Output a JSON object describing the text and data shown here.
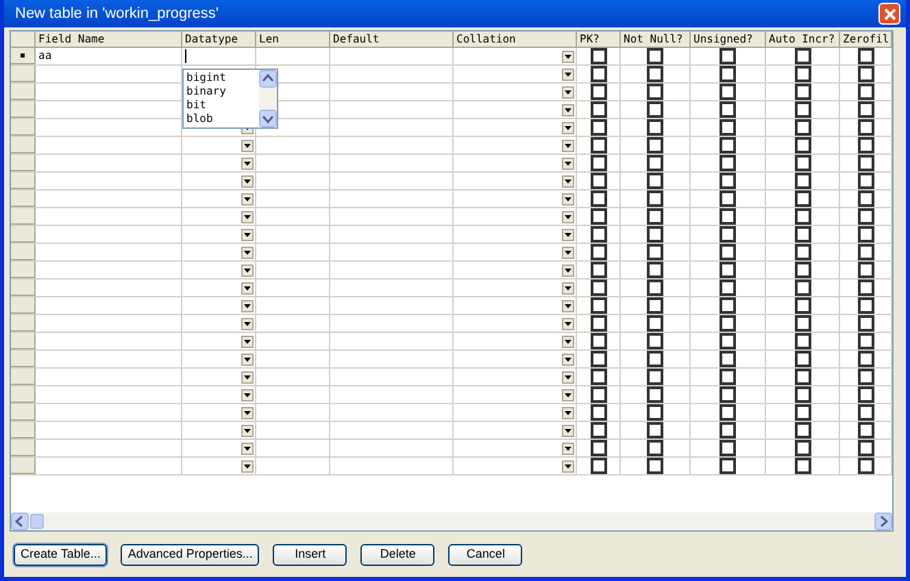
{
  "window": {
    "title": "New table in 'workin_progress'"
  },
  "columns": [
    "Field Name",
    "Datatype",
    "Len",
    "Default",
    "Collation",
    "PK?",
    "Not Null?",
    "Unsigned?",
    "Auto Incr?",
    "Zerofil"
  ],
  "rows": [
    {
      "field_name": "aa",
      "current": true,
      "checks": [
        false,
        false,
        false,
        false,
        false
      ]
    },
    {
      "field_name": "",
      "current": false,
      "checks": [
        false,
        false,
        false,
        false,
        false
      ]
    },
    {
      "field_name": "",
      "current": false,
      "checks": [
        false,
        false,
        false,
        false,
        false
      ]
    },
    {
      "field_name": "",
      "current": false,
      "checks": [
        false,
        false,
        false,
        false,
        false
      ]
    },
    {
      "field_name": "",
      "current": false,
      "checks": [
        false,
        false,
        false,
        false,
        false
      ]
    },
    {
      "field_name": "",
      "current": false,
      "checks": [
        false,
        false,
        false,
        false,
        false
      ]
    },
    {
      "field_name": "",
      "current": false,
      "checks": [
        false,
        false,
        false,
        false,
        false
      ]
    },
    {
      "field_name": "",
      "current": false,
      "checks": [
        false,
        false,
        false,
        false,
        false
      ]
    },
    {
      "field_name": "",
      "current": false,
      "checks": [
        false,
        false,
        false,
        false,
        false
      ]
    },
    {
      "field_name": "",
      "current": false,
      "checks": [
        false,
        false,
        false,
        false,
        false
      ]
    },
    {
      "field_name": "",
      "current": false,
      "checks": [
        false,
        false,
        false,
        false,
        false
      ]
    },
    {
      "field_name": "",
      "current": false,
      "checks": [
        false,
        false,
        false,
        false,
        false
      ]
    },
    {
      "field_name": "",
      "current": false,
      "checks": [
        false,
        false,
        false,
        false,
        false
      ]
    },
    {
      "field_name": "",
      "current": false,
      "checks": [
        false,
        false,
        false,
        false,
        false
      ]
    },
    {
      "field_name": "",
      "current": false,
      "checks": [
        false,
        false,
        false,
        false,
        false
      ]
    },
    {
      "field_name": "",
      "current": false,
      "checks": [
        false,
        false,
        false,
        false,
        false
      ]
    },
    {
      "field_name": "",
      "current": false,
      "checks": [
        false,
        false,
        false,
        false,
        false
      ]
    },
    {
      "field_name": "",
      "current": false,
      "checks": [
        false,
        false,
        false,
        false,
        false
      ]
    },
    {
      "field_name": "",
      "current": false,
      "checks": [
        false,
        false,
        false,
        false,
        false
      ]
    },
    {
      "field_name": "",
      "current": false,
      "checks": [
        false,
        false,
        false,
        false,
        false
      ]
    },
    {
      "field_name": "",
      "current": false,
      "checks": [
        false,
        false,
        false,
        false,
        false
      ]
    },
    {
      "field_name": "",
      "current": false,
      "checks": [
        false,
        false,
        false,
        false,
        false
      ]
    },
    {
      "field_name": "",
      "current": false,
      "checks": [
        false,
        false,
        false,
        false,
        false
      ]
    },
    {
      "field_name": "",
      "current": false,
      "checks": [
        false,
        false,
        false,
        false,
        false
      ]
    }
  ],
  "datatype_dropdown": {
    "items": [
      "bigint",
      "binary",
      "bit",
      "blob"
    ]
  },
  "buttons": [
    "Create Table...",
    "Advanced Properties...",
    "Insert",
    "Delete",
    "Cancel"
  ]
}
